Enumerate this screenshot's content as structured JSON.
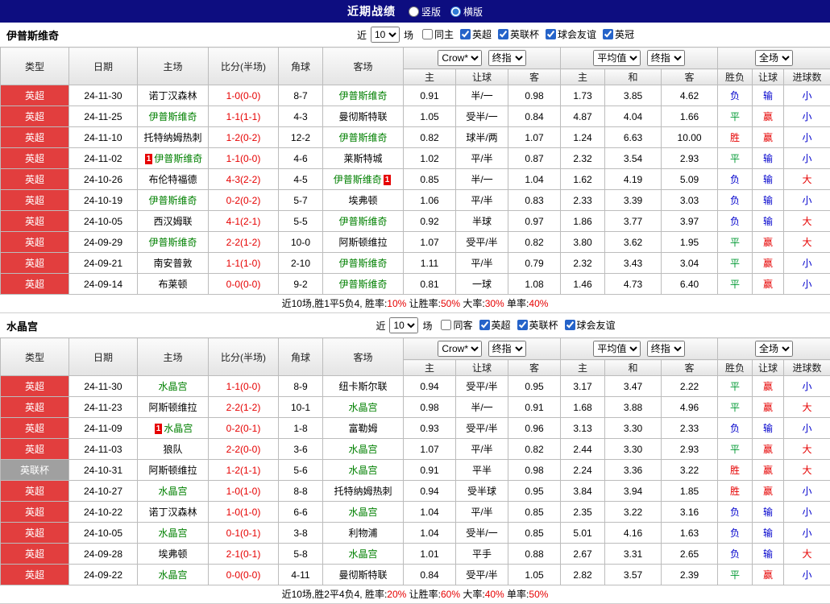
{
  "top_bar": {
    "title": "近期战绩",
    "layout_options": [
      {
        "label": "竖版",
        "selected": false
      },
      {
        "label": "横版",
        "selected": true
      }
    ]
  },
  "sections": [
    {
      "team": "伊普斯维奇",
      "filter": {
        "near_label": "近",
        "count": "10",
        "unit_label": "场",
        "checkboxes": [
          {
            "label": "同主",
            "checked": false
          },
          {
            "label": "英超",
            "checked": true
          },
          {
            "label": "英联杯",
            "checked": true
          },
          {
            "label": "球会友谊",
            "checked": true
          },
          {
            "label": "英冠",
            "checked": true
          }
        ]
      },
      "table": {
        "static_cols": [
          "类型",
          "日期",
          "主场",
          "比分(半场)",
          "角球",
          "客场"
        ],
        "odds_group": {
          "selects": [
            "Crow*",
            "终指"
          ],
          "subs": [
            "主",
            "让球",
            "客"
          ]
        },
        "avg_group": {
          "selects": [
            "平均值",
            "终指"
          ],
          "subs": [
            "主",
            "和",
            "客"
          ]
        },
        "result_group": {
          "selects": [
            "全场"
          ],
          "subs": [
            "胜负",
            "让球",
            "进球数"
          ]
        },
        "rows": [
          {
            "league": "英超",
            "league_color": "red",
            "date": "24-11-30",
            "home": "诺丁汉森林",
            "home_focus": false,
            "score": "1-0(0-0)",
            "corners": "8-7",
            "away": "伊普斯维奇",
            "away_focus": true,
            "odds": [
              "0.91",
              "半/一",
              "0.98"
            ],
            "avg": [
              "1.73",
              "3.85",
              "4.62"
            ],
            "results": [
              "负",
              "输",
              "小"
            ]
          },
          {
            "league": "英超",
            "league_color": "red",
            "date": "24-11-25",
            "home": "伊普斯维奇",
            "home_focus": true,
            "score": "1-1(1-1)",
            "corners": "4-3",
            "away": "曼彻斯特联",
            "away_focus": false,
            "odds": [
              "1.05",
              "受半/一",
              "0.84"
            ],
            "avg": [
              "4.87",
              "4.04",
              "1.66"
            ],
            "results": [
              "平",
              "赢",
              "小"
            ]
          },
          {
            "league": "英超",
            "league_color": "red",
            "date": "24-11-10",
            "home": "托特纳姆热刺",
            "home_focus": false,
            "score": "1-2(0-2)",
            "corners": "12-2",
            "away": "伊普斯维奇",
            "away_focus": true,
            "odds": [
              "0.82",
              "球半/两",
              "1.07"
            ],
            "avg": [
              "1.24",
              "6.63",
              "10.00"
            ],
            "results": [
              "胜",
              "赢",
              "小"
            ]
          },
          {
            "league": "英超",
            "league_color": "red",
            "date": "24-11-02",
            "home": "伊普斯维奇",
            "home_focus": true,
            "home_badge": "1",
            "home_badge_pos": "before",
            "score": "1-1(0-0)",
            "corners": "4-6",
            "away": "莱斯特城",
            "away_focus": false,
            "odds": [
              "1.02",
              "平/半",
              "0.87"
            ],
            "avg": [
              "2.32",
              "3.54",
              "2.93"
            ],
            "results": [
              "平",
              "输",
              "小"
            ]
          },
          {
            "league": "英超",
            "league_color": "red",
            "date": "24-10-26",
            "home": "布伦特福德",
            "home_focus": false,
            "score": "4-3(2-2)",
            "corners": "4-5",
            "away": "伊普斯维奇",
            "away_focus": true,
            "away_badge": "1",
            "away_badge_pos": "after",
            "odds": [
              "0.85",
              "半/一",
              "1.04"
            ],
            "avg": [
              "1.62",
              "4.19",
              "5.09"
            ],
            "results": [
              "负",
              "输",
              "大"
            ]
          },
          {
            "league": "英超",
            "league_color": "red",
            "date": "24-10-19",
            "home": "伊普斯维奇",
            "home_focus": true,
            "score": "0-2(0-2)",
            "corners": "5-7",
            "away": "埃弗顿",
            "away_focus": false,
            "odds": [
              "1.06",
              "平/半",
              "0.83"
            ],
            "avg": [
              "2.33",
              "3.39",
              "3.03"
            ],
            "results": [
              "负",
              "输",
              "小"
            ]
          },
          {
            "league": "英超",
            "league_color": "red",
            "date": "24-10-05",
            "home": "西汉姆联",
            "home_focus": false,
            "score": "4-1(2-1)",
            "corners": "5-5",
            "away": "伊普斯维奇",
            "away_focus": true,
            "odds": [
              "0.92",
              "半球",
              "0.97"
            ],
            "avg": [
              "1.86",
              "3.77",
              "3.97"
            ],
            "results": [
              "负",
              "输",
              "大"
            ]
          },
          {
            "league": "英超",
            "league_color": "red",
            "date": "24-09-29",
            "home": "伊普斯维奇",
            "home_focus": true,
            "score": "2-2(1-2)",
            "corners": "10-0",
            "away": "阿斯顿维拉",
            "away_focus": false,
            "odds": [
              "1.07",
              "受平/半",
              "0.82"
            ],
            "avg": [
              "3.80",
              "3.62",
              "1.95"
            ],
            "results": [
              "平",
              "赢",
              "大"
            ]
          },
          {
            "league": "英超",
            "league_color": "red",
            "date": "24-09-21",
            "home": "南安普敦",
            "home_focus": false,
            "score": "1-1(1-0)",
            "corners": "2-10",
            "away": "伊普斯维奇",
            "away_focus": true,
            "odds": [
              "1.11",
              "平/半",
              "0.79"
            ],
            "avg": [
              "2.32",
              "3.43",
              "3.04"
            ],
            "results": [
              "平",
              "赢",
              "小"
            ]
          },
          {
            "league": "英超",
            "league_color": "red",
            "date": "24-09-14",
            "home": "布莱顿",
            "home_focus": false,
            "score": "0-0(0-0)",
            "corners": "9-2",
            "away": "伊普斯维奇",
            "away_focus": true,
            "odds": [
              "0.81",
              "一球",
              "1.08"
            ],
            "avg": [
              "1.46",
              "4.73",
              "6.40"
            ],
            "results": [
              "平",
              "赢",
              "小"
            ]
          }
        ]
      },
      "summary": {
        "record": "近10场,胜1平5负4,",
        "stats": [
          {
            "label": "胜率:",
            "value": "10%"
          },
          {
            "label": "让胜率:",
            "value": "50%"
          },
          {
            "label": "大率:",
            "value": "30%"
          },
          {
            "label": "单率:",
            "value": "40%"
          }
        ]
      }
    },
    {
      "team": "水晶宫",
      "filter": {
        "near_label": "近",
        "count": "10",
        "unit_label": "场",
        "checkboxes": [
          {
            "label": "同客",
            "checked": false
          },
          {
            "label": "英超",
            "checked": true
          },
          {
            "label": "英联杯",
            "checked": true
          },
          {
            "label": "球会友谊",
            "checked": true
          }
        ]
      },
      "table": {
        "static_cols": [
          "类型",
          "日期",
          "主场",
          "比分(半场)",
          "角球",
          "客场"
        ],
        "odds_group": {
          "selects": [
            "Crow*",
            "终指"
          ],
          "subs": [
            "主",
            "让球",
            "客"
          ]
        },
        "avg_group": {
          "selects": [
            "平均值",
            "终指"
          ],
          "subs": [
            "主",
            "和",
            "客"
          ]
        },
        "result_group": {
          "selects": [
            "全场"
          ],
          "subs": [
            "胜负",
            "让球",
            "进球数"
          ]
        },
        "rows": [
          {
            "league": "英超",
            "league_color": "red",
            "date": "24-11-30",
            "home": "水晶宫",
            "home_focus": true,
            "score": "1-1(0-0)",
            "corners": "8-9",
            "away": "纽卡斯尔联",
            "away_focus": false,
            "odds": [
              "0.94",
              "受平/半",
              "0.95"
            ],
            "avg": [
              "3.17",
              "3.47",
              "2.22"
            ],
            "results": [
              "平",
              "赢",
              "小"
            ]
          },
          {
            "league": "英超",
            "league_color": "red",
            "date": "24-11-23",
            "home": "阿斯顿维拉",
            "home_focus": false,
            "score": "2-2(1-2)",
            "corners": "10-1",
            "away": "水晶宫",
            "away_focus": true,
            "odds": [
              "0.98",
              "半/一",
              "0.91"
            ],
            "avg": [
              "1.68",
              "3.88",
              "4.96"
            ],
            "results": [
              "平",
              "赢",
              "大"
            ]
          },
          {
            "league": "英超",
            "league_color": "red",
            "date": "24-11-09",
            "home": "水晶宫",
            "home_focus": true,
            "home_badge": "1",
            "home_badge_pos": "before",
            "score": "0-2(0-1)",
            "corners": "1-8",
            "away": "富勒姆",
            "away_focus": false,
            "odds": [
              "0.93",
              "受平/半",
              "0.96"
            ],
            "avg": [
              "3.13",
              "3.30",
              "2.33"
            ],
            "results": [
              "负",
              "输",
              "小"
            ]
          },
          {
            "league": "英超",
            "league_color": "red",
            "date": "24-11-03",
            "home": "狼队",
            "home_focus": false,
            "score": "2-2(0-0)",
            "corners": "3-6",
            "away": "水晶宫",
            "away_focus": true,
            "odds": [
              "1.07",
              "平/半",
              "0.82"
            ],
            "avg": [
              "2.44",
              "3.30",
              "2.93"
            ],
            "results": [
              "平",
              "赢",
              "大"
            ]
          },
          {
            "league": "英联杯",
            "league_color": "gray",
            "date": "24-10-31",
            "home": "阿斯顿维拉",
            "home_focus": false,
            "score": "1-2(1-1)",
            "corners": "5-6",
            "away": "水晶宫",
            "away_focus": true,
            "odds": [
              "0.91",
              "平半",
              "0.98"
            ],
            "avg": [
              "2.24",
              "3.36",
              "3.22"
            ],
            "results": [
              "胜",
              "赢",
              "大"
            ]
          },
          {
            "league": "英超",
            "league_color": "red",
            "date": "24-10-27",
            "home": "水晶宫",
            "home_focus": true,
            "score": "1-0(1-0)",
            "corners": "8-8",
            "away": "托特纳姆热刺",
            "away_focus": false,
            "odds": [
              "0.94",
              "受半球",
              "0.95"
            ],
            "avg": [
              "3.84",
              "3.94",
              "1.85"
            ],
            "results": [
              "胜",
              "赢",
              "小"
            ]
          },
          {
            "league": "英超",
            "league_color": "red",
            "date": "24-10-22",
            "home": "诺丁汉森林",
            "home_focus": false,
            "score": "1-0(1-0)",
            "corners": "6-6",
            "away": "水晶宫",
            "away_focus": true,
            "odds": [
              "1.04",
              "平/半",
              "0.85"
            ],
            "avg": [
              "2.35",
              "3.22",
              "3.16"
            ],
            "results": [
              "负",
              "输",
              "小"
            ]
          },
          {
            "league": "英超",
            "league_color": "red",
            "date": "24-10-05",
            "home": "水晶宫",
            "home_focus": true,
            "score": "0-1(0-1)",
            "corners": "3-8",
            "away": "利物浦",
            "away_focus": false,
            "odds": [
              "1.04",
              "受半/一",
              "0.85"
            ],
            "avg": [
              "5.01",
              "4.16",
              "1.63"
            ],
            "results": [
              "负",
              "输",
              "小"
            ]
          },
          {
            "league": "英超",
            "league_color": "red",
            "date": "24-09-28",
            "home": "埃弗顿",
            "home_focus": false,
            "score": "2-1(0-1)",
            "corners": "5-8",
            "away": "水晶宫",
            "away_focus": true,
            "odds": [
              "1.01",
              "平手",
              "0.88"
            ],
            "avg": [
              "2.67",
              "3.31",
              "2.65"
            ],
            "results": [
              "负",
              "输",
              "大"
            ]
          },
          {
            "league": "英超",
            "league_color": "red",
            "date": "24-09-22",
            "home": "水晶宫",
            "home_focus": true,
            "score": "0-0(0-0)",
            "corners": "4-11",
            "away": "曼彻斯特联",
            "away_focus": false,
            "odds": [
              "0.84",
              "受平/半",
              "1.05"
            ],
            "avg": [
              "2.82",
              "3.57",
              "2.39"
            ],
            "results": [
              "平",
              "赢",
              "小"
            ]
          }
        ]
      },
      "summary": {
        "record": "近10场,胜2平4负4,",
        "stats": [
          {
            "label": "胜率:",
            "value": "20%"
          },
          {
            "label": "让胜率:",
            "value": "60%"
          },
          {
            "label": "大率:",
            "value": "40%"
          },
          {
            "label": "单率:",
            "value": "50%"
          }
        ]
      }
    }
  ]
}
